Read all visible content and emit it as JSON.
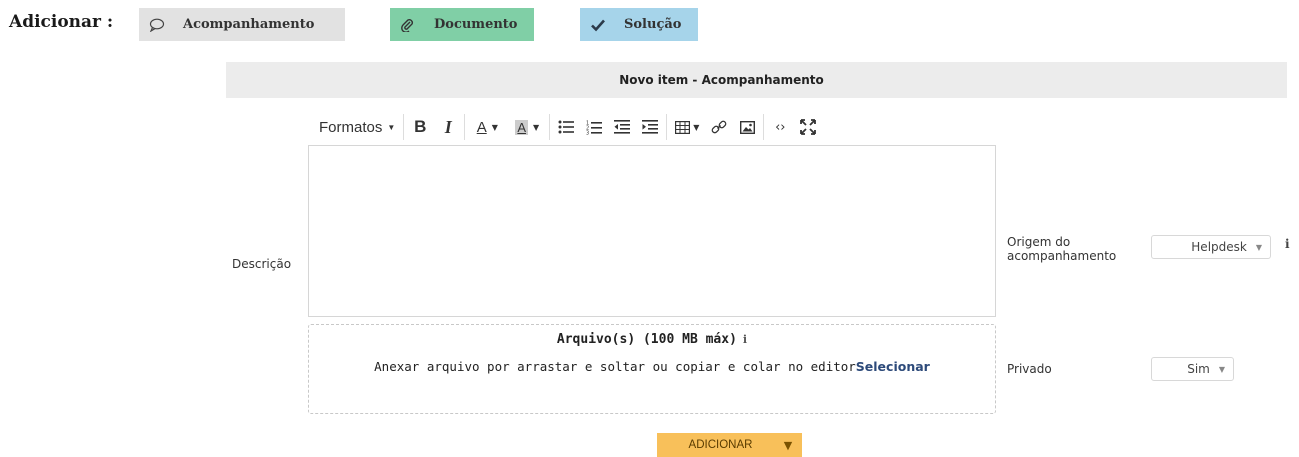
{
  "add_row": {
    "label": "Adicionar :",
    "buttons": [
      {
        "label": "Acompanhamento",
        "icon": "speech-bubble-icon",
        "color": "#e2e2e2"
      },
      {
        "label": "Documento",
        "icon": "paperclip-icon",
        "color": "#80cfa6"
      },
      {
        "label": "Solução",
        "icon": "checkmark-icon",
        "color": "#a6d4ea"
      }
    ]
  },
  "form": {
    "header": "Novo item - Acompanhamento",
    "toolbar": {
      "formats": "Formatos",
      "items": [
        "bold-icon",
        "italic-icon",
        "text-color-icon",
        "background-color-icon",
        "bullet-list-icon",
        "numbered-list-icon",
        "outdent-icon",
        "indent-icon",
        "table-icon",
        "link-icon",
        "image-icon",
        "code-icon",
        "fullscreen-icon"
      ]
    },
    "description_label": "Descrição",
    "dropzone": {
      "title": "Arquivo(s) (100 MB máx)",
      "info": "i",
      "text": "Anexar arquivo por arrastar e soltar ou copiar e colar no editor",
      "select_link": "Selecionar"
    },
    "origem": {
      "label_line1": "Origem do",
      "label_line2": "acompanhamento",
      "value": "Helpdesk",
      "info": "i"
    },
    "privado": {
      "label": "Privado",
      "value": "Sim"
    },
    "submit": {
      "label": "ADICIONAR",
      "color": "#f8c05a"
    }
  }
}
